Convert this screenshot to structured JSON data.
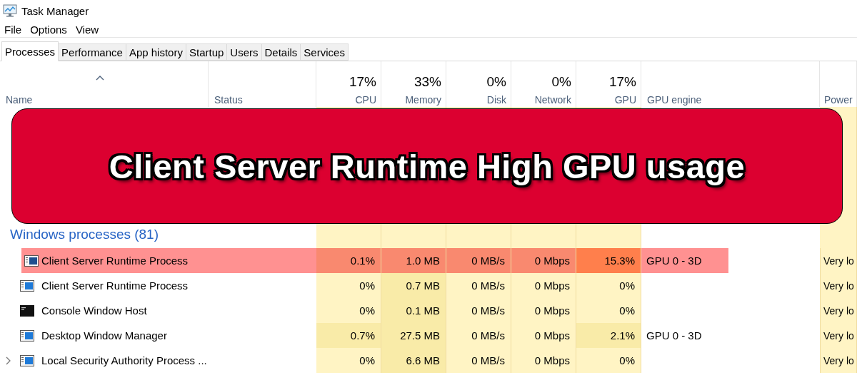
{
  "window": {
    "title": "Task Manager"
  },
  "menu": [
    "File",
    "Options",
    "View"
  ],
  "tabs": [
    {
      "label": "Processes",
      "selected": true
    },
    {
      "label": "Performance",
      "selected": false
    },
    {
      "label": "App history",
      "selected": false
    },
    {
      "label": "Startup",
      "selected": false
    },
    {
      "label": "Users",
      "selected": false
    },
    {
      "label": "Details",
      "selected": false
    },
    {
      "label": "Services",
      "selected": false
    }
  ],
  "table": {
    "columns": [
      {
        "label": "Name",
        "kind": "name"
      },
      {
        "label": "Status",
        "kind": "text"
      },
      {
        "label": "CPU",
        "kind": "metric",
        "total": "17%"
      },
      {
        "label": "Memory",
        "kind": "metric",
        "total": "33%"
      },
      {
        "label": "Disk",
        "kind": "metric",
        "total": "0%"
      },
      {
        "label": "Network",
        "kind": "metric",
        "total": "0%"
      },
      {
        "label": "GPU",
        "kind": "metric",
        "total": "17%"
      },
      {
        "label": "GPU engine",
        "kind": "text"
      },
      {
        "label": "Power",
        "kind": "power"
      }
    ],
    "group": {
      "label": "Windows processes (81)"
    },
    "rows": [
      {
        "name": "Client Server Runtime Process",
        "kind": "app",
        "expandable": false,
        "highlighted": true,
        "metrics": [
          {
            "text": "0.1%",
            "color": "#f9896f"
          },
          {
            "text": "1.0 MB",
            "color": "#f9896f"
          },
          {
            "text": "0 MB/s",
            "color": "#f9896f"
          },
          {
            "text": "0 Mbps",
            "color": "#f9896f"
          },
          {
            "text": "15.3%",
            "color": "#ff7f4c"
          }
        ],
        "gpu_engine": "GPU 0 - 3D",
        "power": "Very lo"
      },
      {
        "name": "Client Server Runtime Process",
        "kind": "app",
        "expandable": false,
        "highlighted": false,
        "metrics": [
          {
            "text": "0%",
            "color": "#fff4c4"
          },
          {
            "text": "0.7 MB",
            "color": "#f9eba8"
          },
          {
            "text": "0 MB/s",
            "color": "#fff4c4"
          },
          {
            "text": "0 Mbps",
            "color": "#fff4c4"
          },
          {
            "text": "0%",
            "color": "#fff4c4"
          }
        ],
        "power": "Very lo"
      },
      {
        "name": "Console Window Host",
        "kind": "console",
        "expandable": false,
        "highlighted": false,
        "metrics": [
          {
            "text": "0%",
            "color": "#fff4c4"
          },
          {
            "text": "0.1 MB",
            "color": "#f9eba8"
          },
          {
            "text": "0 MB/s",
            "color": "#fff4c4"
          },
          {
            "text": "0 Mbps",
            "color": "#fff4c4"
          },
          {
            "text": "0%",
            "color": "#fff4c4"
          }
        ],
        "power": "Very lo"
      },
      {
        "name": "Desktop Window Manager",
        "kind": "app",
        "expandable": false,
        "highlighted": false,
        "metrics": [
          {
            "text": "0.7%",
            "color": "#f9eba8"
          },
          {
            "text": "27.5 MB",
            "color": "#f9eba8"
          },
          {
            "text": "0 MB/s",
            "color": "#fff4c4"
          },
          {
            "text": "0 Mbps",
            "color": "#fff4c4"
          },
          {
            "text": "2.1%",
            "color": "#f9eba8"
          }
        ],
        "gpu_engine": "GPU 0 - 3D",
        "power": "Very lo"
      },
      {
        "name": "Local Security Authority Process ...",
        "kind": "app",
        "expandable": true,
        "highlighted": false,
        "metrics": [
          {
            "text": "0%",
            "color": "#fff4c4"
          },
          {
            "text": "6.6 MB",
            "color": "#f9eba8"
          },
          {
            "text": "0 MB/s",
            "color": "#fff4c4"
          },
          {
            "text": "0 Mbps",
            "color": "#fff4c4"
          },
          {
            "text": "0%",
            "color": "#fff4c4"
          }
        ],
        "power": "Very lo"
      }
    ]
  },
  "banner": {
    "title": "Client Server Runtime High GPU usage"
  }
}
